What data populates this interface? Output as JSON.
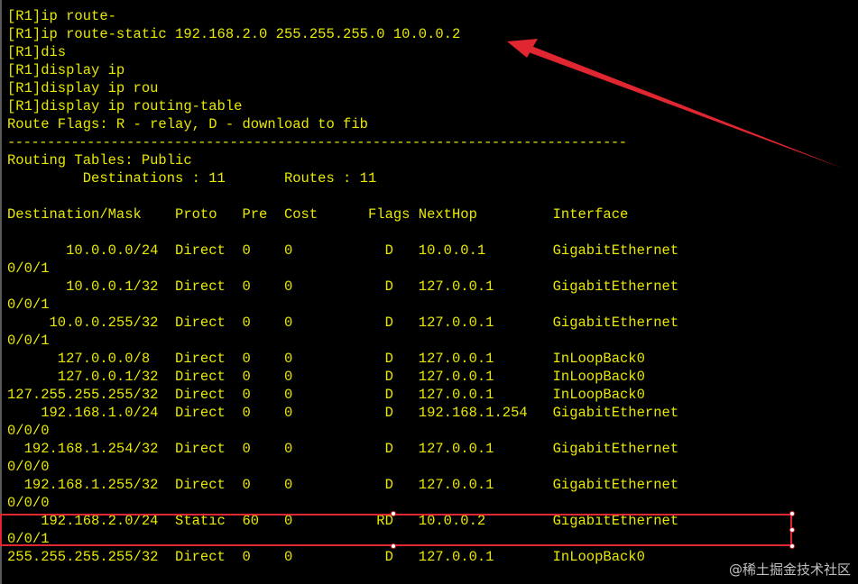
{
  "terminal": {
    "lines": [
      "[R1]ip route-",
      "[R1]ip route-static 192.168.2.0 255.255.255.0 10.0.0.2",
      "[R1]dis",
      "[R1]display ip",
      "[R1]display ip rou",
      "[R1]display ip routing-table",
      "Route Flags: R - relay, D - download to fib",
      "------------------------------------------------------------------------------",
      "Routing Tables: Public",
      "         Destinations : 11       Routes : 11",
      "",
      "Destination/Mask    Proto   Pre  Cost      Flags NextHop         Interface",
      "",
      "       10.0.0.0/24  Direct  0    0           D   10.0.0.1        GigabitEthernet",
      "0/0/1",
      "       10.0.0.1/32  Direct  0    0           D   127.0.0.1       GigabitEthernet",
      "0/0/1",
      "     10.0.0.255/32  Direct  0    0           D   127.0.0.1       GigabitEthernet",
      "0/0/1",
      "      127.0.0.0/8   Direct  0    0           D   127.0.0.1       InLoopBack0",
      "      127.0.0.1/32  Direct  0    0           D   127.0.0.1       InLoopBack0",
      "127.255.255.255/32  Direct  0    0           D   127.0.0.1       InLoopBack0",
      "    192.168.1.0/24  Direct  0    0           D   192.168.1.254   GigabitEthernet",
      "0/0/0",
      "  192.168.1.254/32  Direct  0    0           D   127.0.0.1       GigabitEthernet",
      "0/0/0",
      "  192.168.1.255/32  Direct  0    0           D   127.0.0.1       GigabitEthernet",
      "0/0/0",
      "    192.168.2.0/24  Static  60   0          RD   10.0.0.2        GigabitEthernet",
      "0/0/1",
      "255.255.255.255/32  Direct  0    0           D   127.0.0.1       InLoopBack0"
    ]
  },
  "watermark": "@稀土掘金技术社区",
  "colors": {
    "background": "#000000",
    "text": "#e8e800",
    "annotation": "#e02630"
  }
}
